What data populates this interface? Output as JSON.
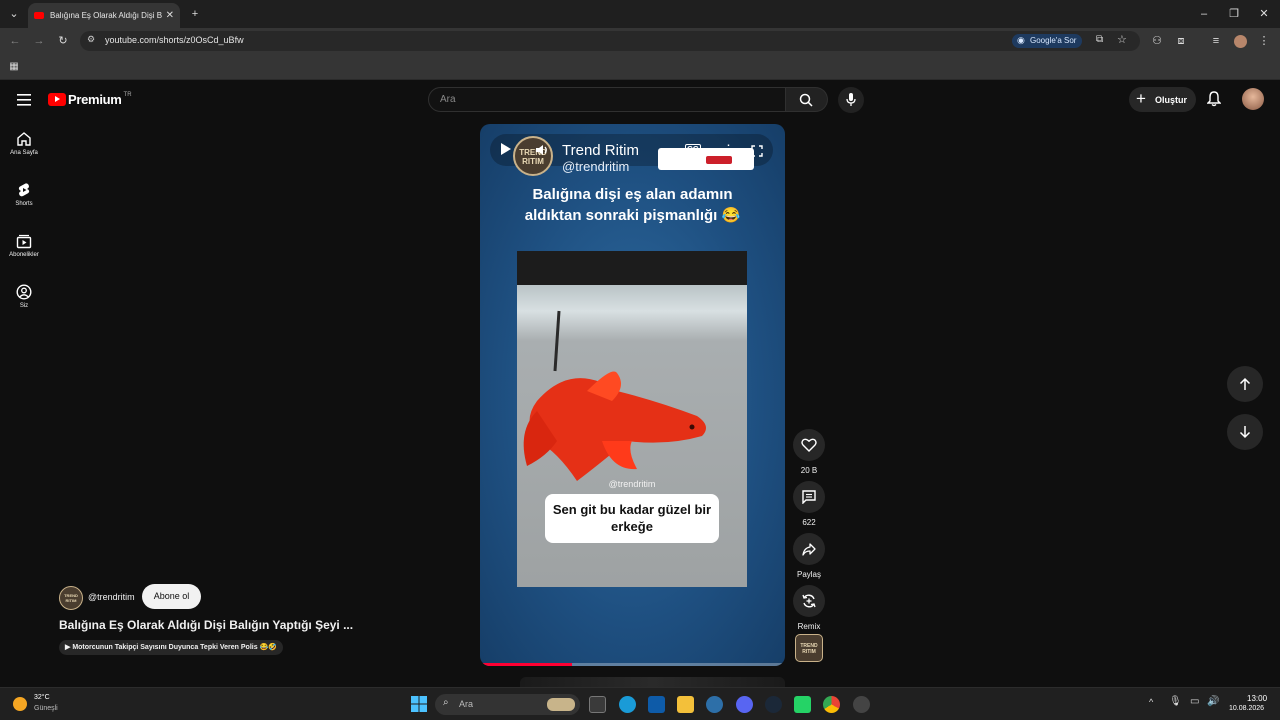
{
  "browser": {
    "tab_title": "Balığına Eş Olarak Aldığı Dişi Ba",
    "url": "youtube.com/shorts/z0OsCd_uBfw",
    "ask_google_label": "Google'a Sor"
  },
  "youtube": {
    "logo_word": "Premium",
    "logo_region": "TR",
    "search_placeholder": "Ara",
    "create_label": "Oluştur",
    "sidebar": [
      {
        "label": "Ana Sayfa",
        "icon": "home-icon"
      },
      {
        "label": "Shorts",
        "icon": "shorts-icon"
      },
      {
        "label": "Abonelikler",
        "icon": "subscriptions-icon"
      },
      {
        "label": "Siz",
        "icon": "you-icon"
      }
    ]
  },
  "short": {
    "overlay_channel_name": "Trend Ritim",
    "overlay_channel_handle": "@trendritim",
    "channel_logo_text": "TREND RITIM",
    "headline": "Balığına dişi eş alan adamın aldıktan sonraki pişmanlığı 😂",
    "watermark": "@trendritim",
    "caption": "Sen git bu kadar güzel bir erkeğe",
    "progress": 0.3
  },
  "actions": {
    "like_count": "20 B",
    "comment_count": "622",
    "share_label": "Paylaş",
    "remix_label": "Remix"
  },
  "meta": {
    "handle": "@trendritim",
    "subscribe_label": "Abone ol",
    "title": "Balığına Eş Olarak Aldığı Dişi Balığın Yaptığı Şeyi ...",
    "related": "Motorcunun Takipçi Sayısını Duyunca Tepki Veren Polis 😂🤣"
  },
  "taskbar": {
    "weather_temp": "32°C",
    "weather_desc": "Güneşli",
    "search_placeholder": "Ara",
    "time": "13:00",
    "date": "10.08.2026"
  },
  "colors": {
    "youtube_red": "#ff0000",
    "background": "#0f0f0f",
    "progress": "#ff0033"
  }
}
